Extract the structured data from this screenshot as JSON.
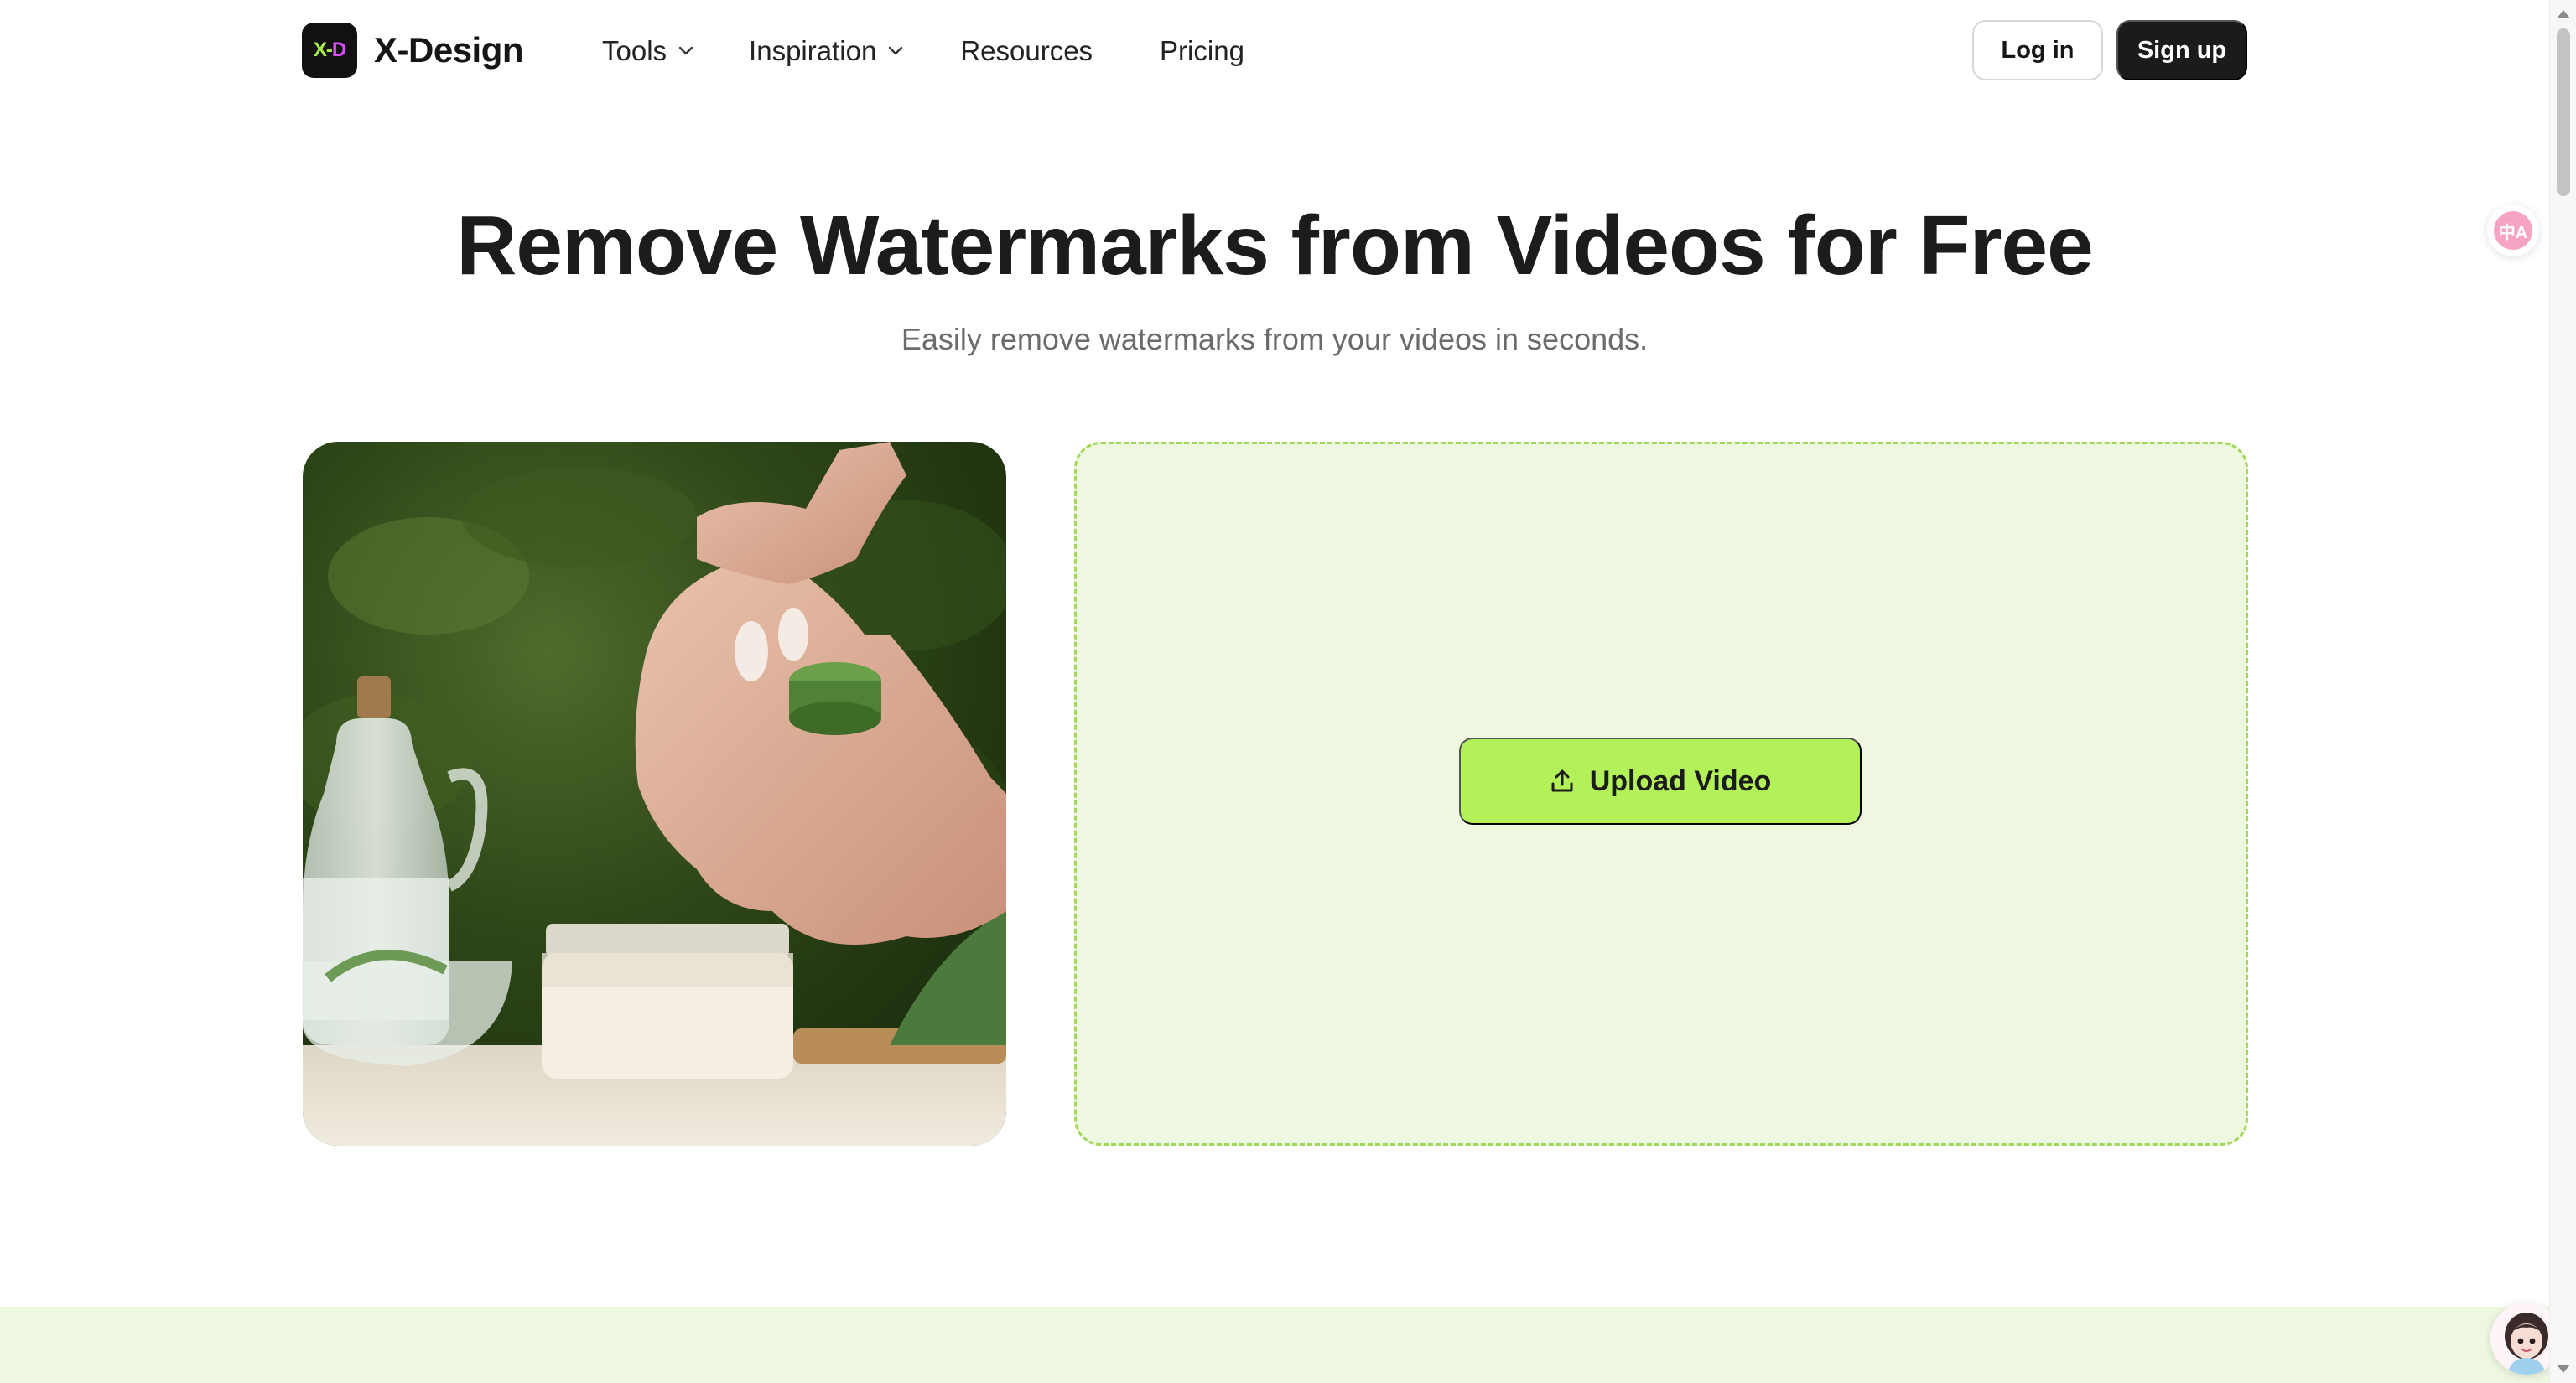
{
  "brand": {
    "logo_mark_x": "X",
    "logo_mark_sep": "-",
    "logo_mark_d": "D",
    "name": "X-Design"
  },
  "nav": {
    "items": [
      {
        "label": "Tools",
        "has_dropdown": true
      },
      {
        "label": "Inspiration",
        "has_dropdown": true
      },
      {
        "label": "Resources",
        "has_dropdown": false
      },
      {
        "label": "Pricing",
        "has_dropdown": false
      }
    ],
    "login_label": "Log in",
    "signup_label": "Sign up"
  },
  "hero": {
    "title": "Remove Watermarks from Videos for Free",
    "subtitle": "Easily remove watermarks from your videos in seconds."
  },
  "upload": {
    "button_label": "Upload Video",
    "icon": "upload-icon"
  },
  "floating": {
    "translate_glyph": "中A",
    "translate_icon": "translate-icon",
    "assistant_icon": "assistant-avatar-icon"
  },
  "colors": {
    "accent": "#b3f158",
    "dropzone_bg": "#eef8e1",
    "dropzone_border": "#a2d85a",
    "dark_button": "#1b1b1b",
    "logo_green": "#a8ef4a",
    "logo_pink": "#e14bff"
  }
}
